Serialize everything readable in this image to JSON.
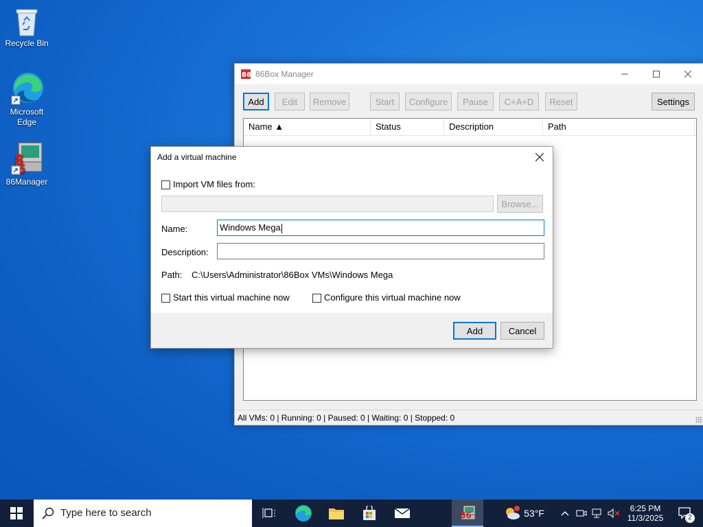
{
  "desktop": {
    "icons": [
      {
        "label": "Recycle Bin"
      },
      {
        "label": "Microsoft\nEdge",
        "line1": "Microsoft",
        "line2": "Edge"
      },
      {
        "label": "86Manager"
      }
    ]
  },
  "manager": {
    "title": "86Box Manager",
    "toolbar": {
      "add": "Add",
      "edit": "Edit",
      "remove": "Remove",
      "start": "Start",
      "configure": "Configure",
      "pause": "Pause",
      "cad": "C+A+D",
      "reset": "Reset",
      "settings": "Settings"
    },
    "columns": {
      "name": "Name ▲",
      "status": "Status",
      "description": "Description",
      "path": "Path"
    },
    "status_bar": "All VMs: 0 | Running: 0 | Paused: 0 | Waiting: 0 | Stopped: 0"
  },
  "dialog": {
    "title": "Add a virtual machine",
    "import_label": "Import VM files from:",
    "import_value": "",
    "browse_label": "Browse...",
    "name_label": "Name:",
    "name_value": "Windows Mega",
    "description_label": "Description:",
    "description_value": "",
    "path_label": "Path:",
    "path_value": "C:\\Users\\Administrator\\86Box VMs\\Windows Mega",
    "start_now_label": "Start this virtual machine now",
    "configure_now_label": "Configure this virtual machine now",
    "add_label": "Add",
    "cancel_label": "Cancel"
  },
  "taskbar": {
    "search_placeholder": "Type here to search",
    "weather": "53°F",
    "time": "6:25 PM",
    "date": "11/3/2025",
    "notifications_count": "2"
  },
  "colors": {
    "accent": "#0078d7",
    "taskbar": "#12203a"
  }
}
